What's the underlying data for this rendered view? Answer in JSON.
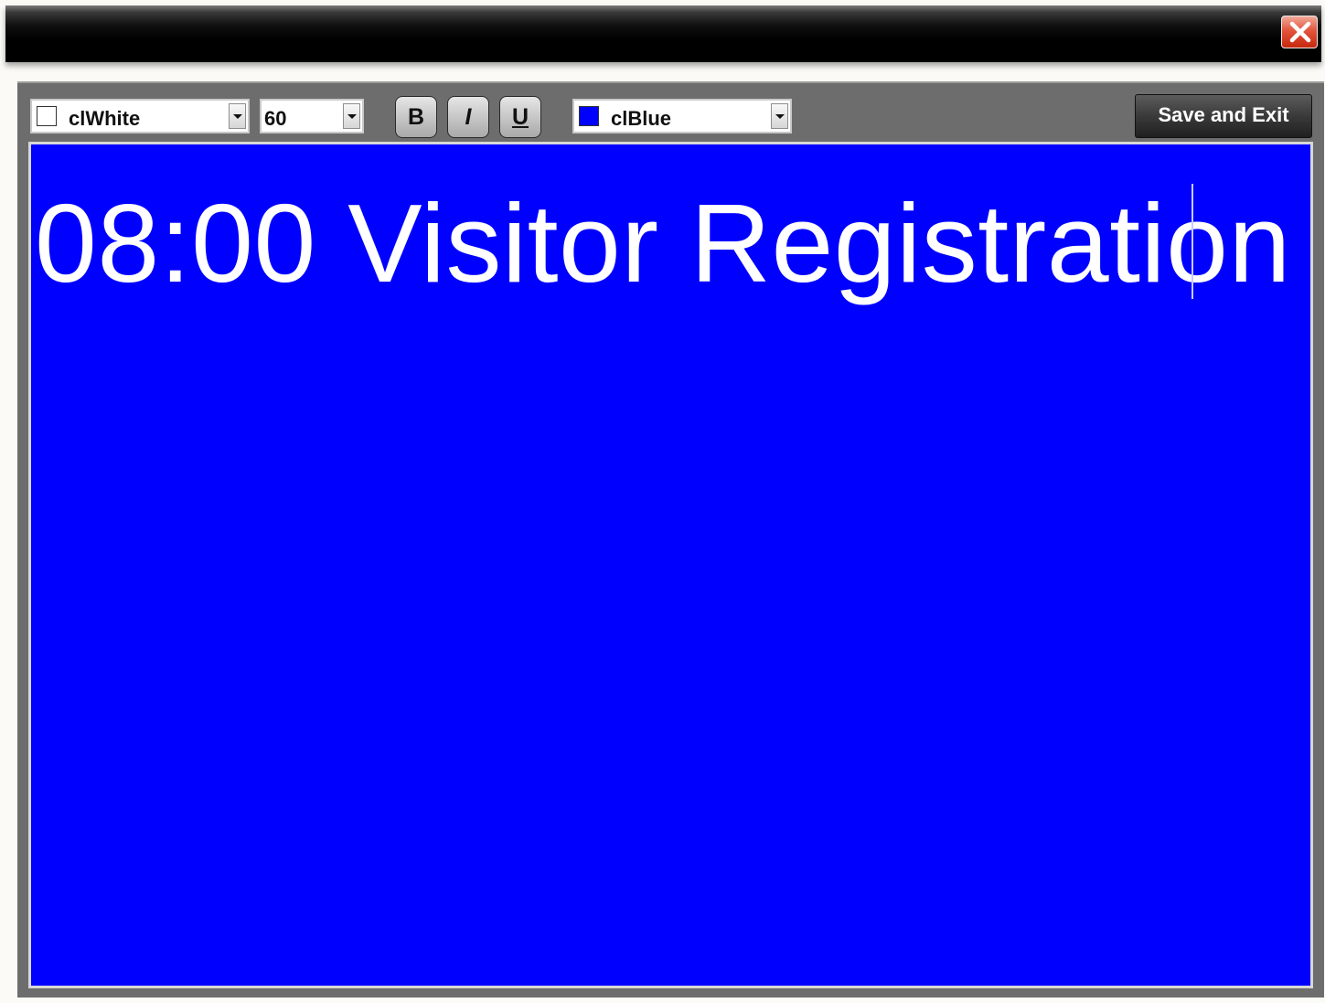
{
  "window": {
    "close_icon": "close-x-icon",
    "close_color": "#d9401f"
  },
  "toolbar": {
    "font_color": {
      "value": "clWhite",
      "swatch": "#ffffff"
    },
    "font_size": {
      "value": "60"
    },
    "bold_label": "B",
    "italic_label": "I",
    "underline_label": "U",
    "background_color": {
      "value": "clBlue",
      "swatch": "#0000ff"
    },
    "save_label": "Save and Exit"
  },
  "editor": {
    "text": "08:00 Visitor Registration",
    "background": "#0000ff",
    "text_color": "#ffffff"
  }
}
